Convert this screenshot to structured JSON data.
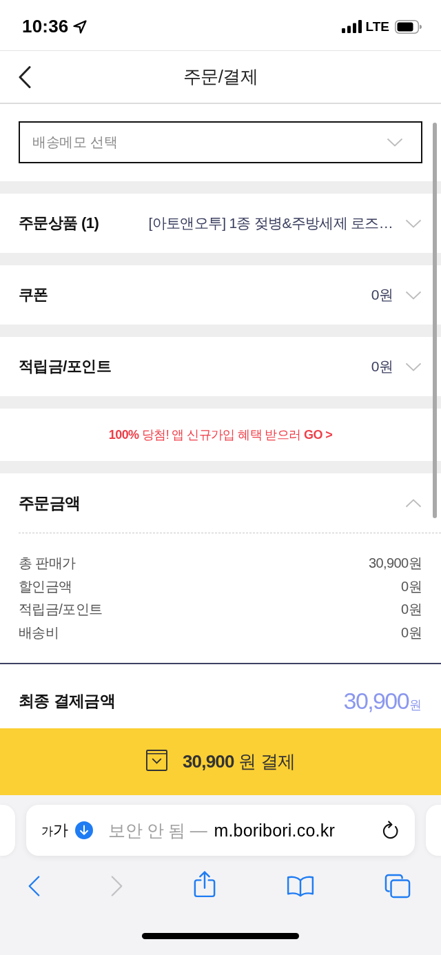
{
  "status_bar": {
    "time": "10:36",
    "network": "LTE"
  },
  "header": {
    "title": "주문/결제"
  },
  "delivery_memo": {
    "placeholder": "배송메모 선택"
  },
  "sections": [
    {
      "label": "주문상품 (1)",
      "value": "[아토앤오투] 1종 젖병&주방세제 로즈…",
      "expanded": false
    },
    {
      "label": "쿠폰",
      "value": "0원",
      "expanded": false
    },
    {
      "label": "적립금/포인트",
      "value": "0원",
      "expanded": false
    }
  ],
  "promo_banner": {
    "text": "**100%** 당첨! 앱 신규가입 혜택 받으러 **GO >**"
  },
  "order_amount": {
    "title": "주문금액",
    "expanded": true,
    "rows": [
      {
        "label": "총 판매가",
        "value": "30,900원"
      },
      {
        "label": "할인금액",
        "value": "0원"
      },
      {
        "label": "적립금/포인트",
        "value": "0원"
      },
      {
        "label": "배송비",
        "value": "0원"
      }
    ]
  },
  "final_payment": {
    "label": "최종 결제금액",
    "amount": "30,900",
    "unit": "원"
  },
  "pay_button": {
    "label": "**30,900** 원 결제"
  },
  "browser": {
    "text_size_button": "가가",
    "security": "보안 안 됨 —",
    "url": "m.boribori.co.kr",
    "toolbar": [
      {
        "kind": "back",
        "disabled": false
      },
      {
        "kind": "forward",
        "disabled": true
      },
      {
        "kind": "share",
        "disabled": false
      },
      {
        "kind": "bookmarks",
        "disabled": false
      },
      {
        "kind": "tabs",
        "disabled": false
      }
    ]
  }
}
